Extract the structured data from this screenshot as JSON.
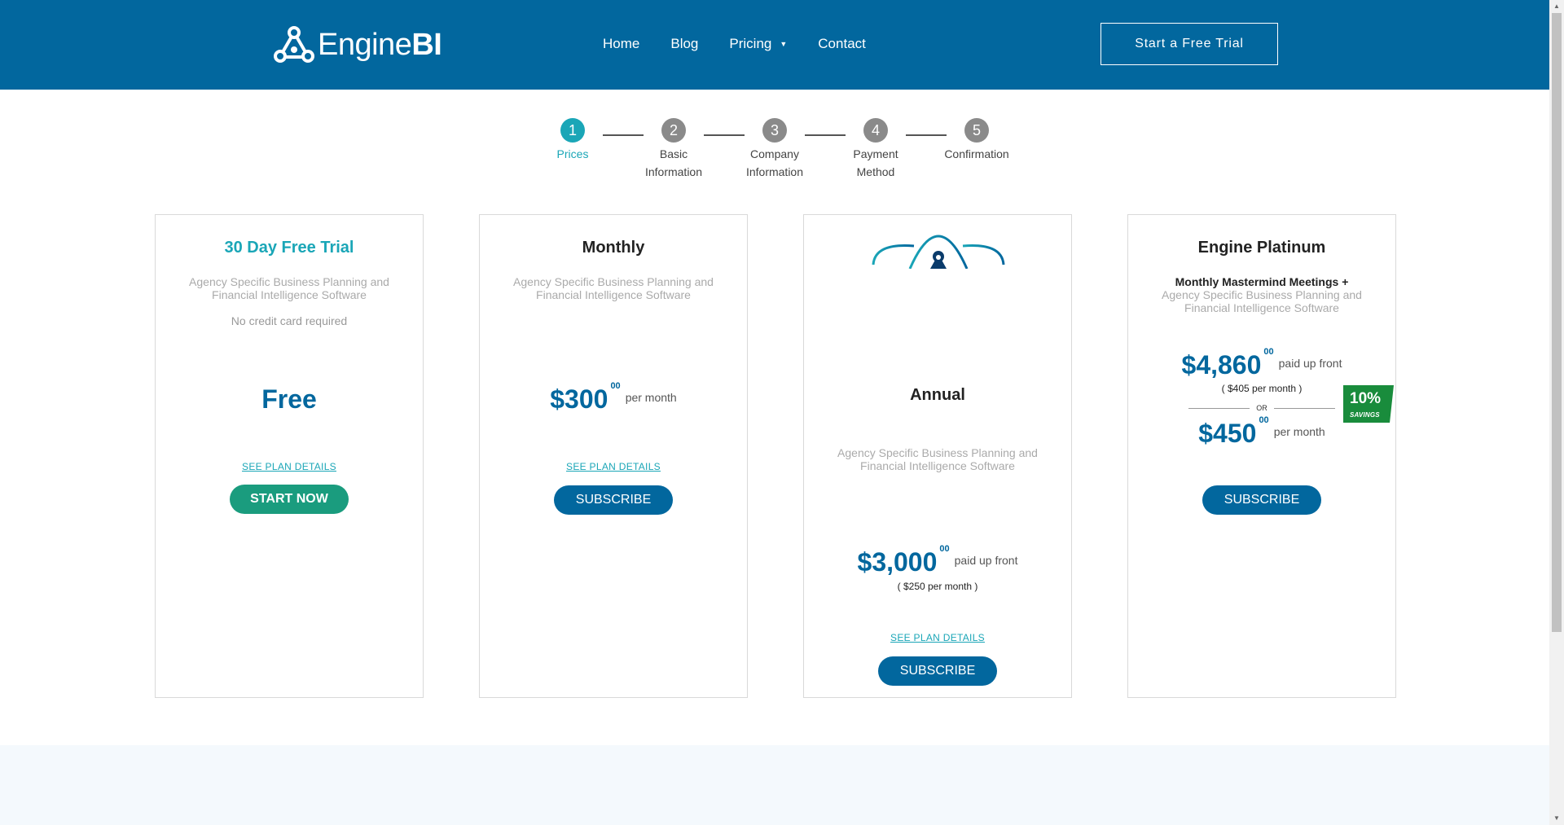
{
  "header": {
    "logo_text_light": "Engine",
    "logo_text_bold": "BI",
    "nav": [
      {
        "label": "Home"
      },
      {
        "label": "Blog"
      },
      {
        "label": "Pricing"
      },
      {
        "label": "Contact"
      }
    ],
    "cta_label": "Start a Free Trial"
  },
  "steps": [
    {
      "number": "1",
      "label_line1": "Prices",
      "label_line2": ""
    },
    {
      "number": "2",
      "label_line1": "Basic",
      "label_line2": "Information"
    },
    {
      "number": "3",
      "label_line1": "Company",
      "label_line2": "Information"
    },
    {
      "number": "4",
      "label_line1": "Payment",
      "label_line2": "Method"
    },
    {
      "number": "5",
      "label_line1": "Confirmation",
      "label_line2": ""
    }
  ],
  "cards": {
    "trial": {
      "title": "30 Day Free Trial",
      "desc": "Agency Specific Business Planning and Financial Intelligence Software",
      "note": "No credit card required",
      "price": "Free",
      "link": "SEE PLAN DETAILS",
      "button": "START NOW"
    },
    "monthly": {
      "title": "Monthly",
      "desc": "Agency Specific Business Planning and Financial Intelligence Software",
      "amount": "$300",
      "cents": "00",
      "suffix": "per month",
      "link": "SEE PLAN DETAILS",
      "button": "SUBSCRIBE"
    },
    "annual": {
      "title": "Annual",
      "desc": "Agency Specific Business Planning and Financial Intelligence Software",
      "amount": "$3,000",
      "cents": "00",
      "suffix": "paid up front",
      "sub": "( $250 per month )",
      "link": "SEE PLAN DETAILS",
      "button": "SUBSCRIBE"
    },
    "platinum": {
      "title": "Engine Platinum",
      "desc_bold": "Monthly Mastermind Meetings +",
      "desc": "Agency Specific Business Planning and Financial Intelligence Software",
      "amount": "$4,860",
      "cents": "00",
      "suffix": "paid up front",
      "sub": "( $405 per month )",
      "or": "OR",
      "amount2": "$450",
      "cents2": "00",
      "suffix2": "per month",
      "badge_pct": "10%",
      "badge_label": "SAVINGS",
      "button": "SUBSCRIBE"
    }
  },
  "colors": {
    "brand_blue": "#02679e",
    "teal": "#1aa6b7",
    "green": "#1a9c7e",
    "badge_green": "#198c3c"
  }
}
